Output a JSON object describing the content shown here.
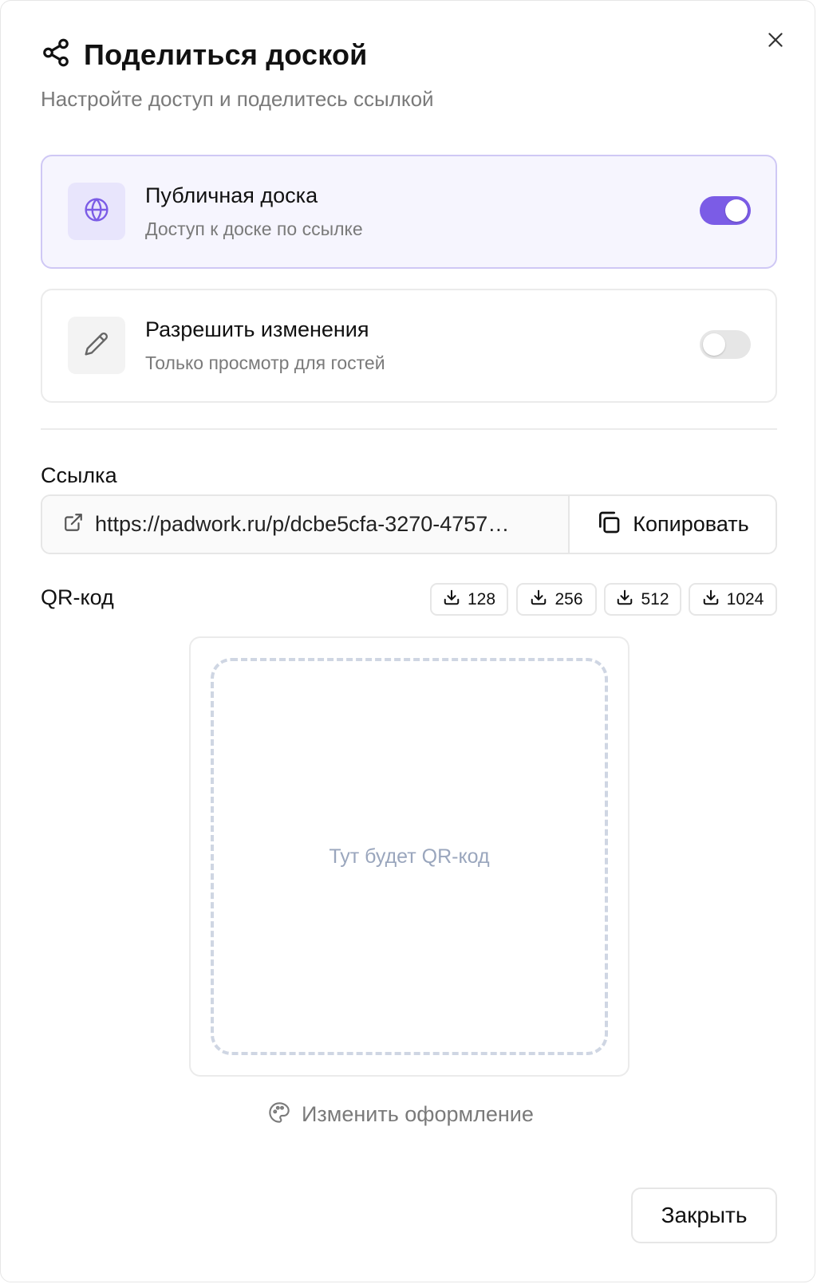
{
  "dialog": {
    "title": "Поделиться доской",
    "subtitle": "Настройте доступ и поделитесь ссылкой",
    "title_icon": "share-icon",
    "close_icon": "close-icon"
  },
  "options": [
    {
      "title": "Публичная доска",
      "description": "Доступ к доске по ссылке",
      "icon": "globe-icon",
      "enabled": true
    },
    {
      "title": "Разрешить изменения",
      "description": "Только просмотр для гостей",
      "icon": "pencil-icon",
      "enabled": false
    }
  ],
  "link": {
    "label": "Ссылка",
    "url": "https://padwork.ru/p/dcbe5cfa-3270-4757…",
    "copy_label": "Копировать",
    "link_icon": "external-link-icon",
    "copy_icon": "copy-icon"
  },
  "qr": {
    "label": "QR-код",
    "download_sizes": [
      "128",
      "256",
      "512",
      "1024"
    ],
    "download_icon": "download-icon",
    "placeholder": "Тут будет QR-код",
    "customize_label": "Изменить оформление",
    "customize_icon": "palette-icon"
  },
  "footer": {
    "close_label": "Закрыть"
  },
  "colors": {
    "accent": "#7b5ce6",
    "accent_light_bg": "#f6f5fe",
    "accent_border": "#cfc8f5",
    "muted_text": "#7a7a7a",
    "qr_placeholder": "#9aa6bd"
  }
}
